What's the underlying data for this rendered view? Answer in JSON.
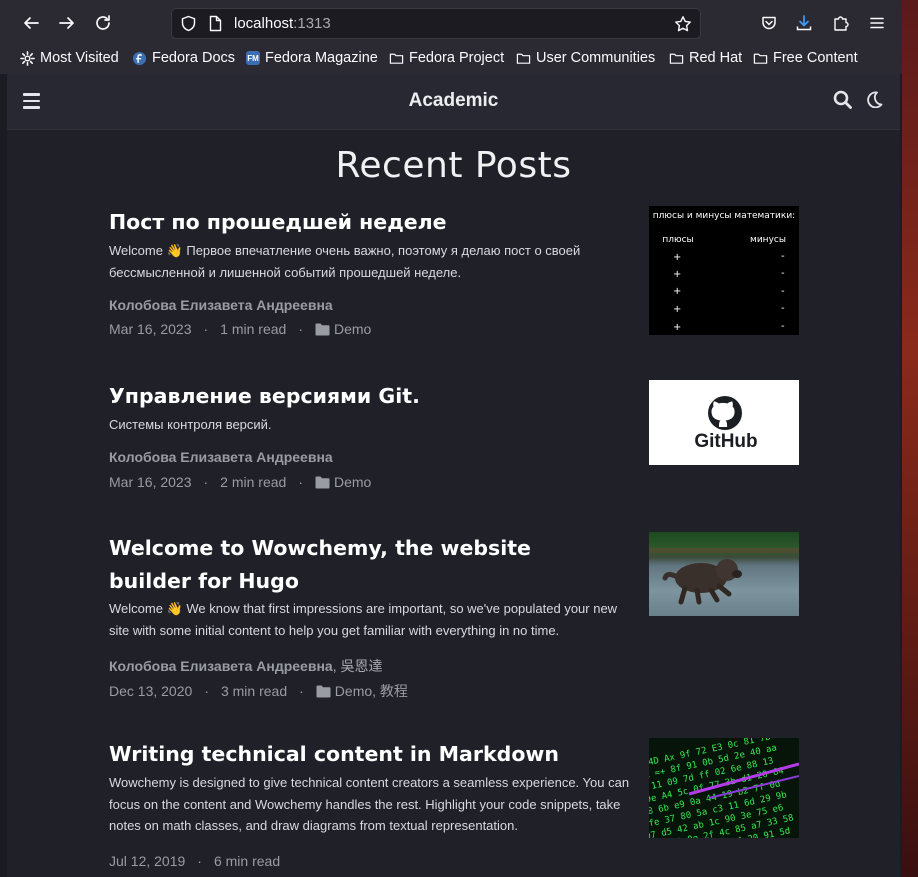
{
  "browser": {
    "url_host": "localhost",
    "url_port": ":1313"
  },
  "bookmarks": [
    {
      "label": "Most Visited",
      "icon": "gear-icon"
    },
    {
      "label": "Fedora Docs",
      "icon": "fedora-icon"
    },
    {
      "label": "Fedora Magazine",
      "icon": "fm-icon",
      "badge": "FM"
    },
    {
      "label": "Fedora Project",
      "icon": "folder-icon"
    },
    {
      "label": "User Communities",
      "icon": "folder-icon"
    },
    {
      "label": "Red Hat",
      "icon": "folder-icon"
    },
    {
      "label": "Free Content",
      "icon": "folder-icon"
    }
  ],
  "site": {
    "title": "Academic"
  },
  "section_title": "Recent Posts",
  "posts": [
    {
      "title": "Пост по прошедшей неделе",
      "summary": "Welcome 👋 Первое впечатление очень важно, поэтому я делаю пост о своей бессмысленной и лишенной событий прошедшей неделе.",
      "author": "Колобова Елизавета Андреевна",
      "date": "Mar 16, 2023",
      "read_time": "1 min read",
      "category": "Demo",
      "thumb": {
        "heading": "плюсы и минусы математики:",
        "col_left": "плюсы",
        "col_right": "минусы",
        "plus": "+",
        "minus": "-"
      }
    },
    {
      "title": "Управление версиями Git.",
      "summary": "Системы контроля версий.",
      "author": "Колобова Елизавета Андреевна",
      "date": "Mar 16, 2023",
      "read_time": "2 min read",
      "category": "Demo",
      "thumb": {
        "logo_text": "GitHub"
      }
    },
    {
      "title": "Welcome to Wowchemy, the website builder for Hugo",
      "summary": "Welcome 👋 We know that first impressions are important, so we've populated your new site with some initial content to help you get familiar with everything in no time.",
      "author": "Колобова Елизавета Андреевна",
      "author_extra": ", 吳恩達",
      "date": "Dec 13, 2020",
      "read_time": "3 min read",
      "category": "Demo, 教程"
    },
    {
      "title": "Writing technical content in Markdown",
      "summary": "Wowchemy is designed to give technical content creators a seamless experience. You can focus on the content and Wowchemy handles the rest. Highlight your code snippets, take notes on math classes, and draw diagrams from textual representation.",
      "date": "Jul 12, 2019",
      "read_time": "6 min read"
    }
  ],
  "meta_separator": "·",
  "colors": {
    "page_bg": "#1f2028",
    "navbar_bg": "#272831",
    "chrome_bg": "#2b2a33",
    "title_text": "#ffffff",
    "meta_text": "#9a9ca4"
  }
}
